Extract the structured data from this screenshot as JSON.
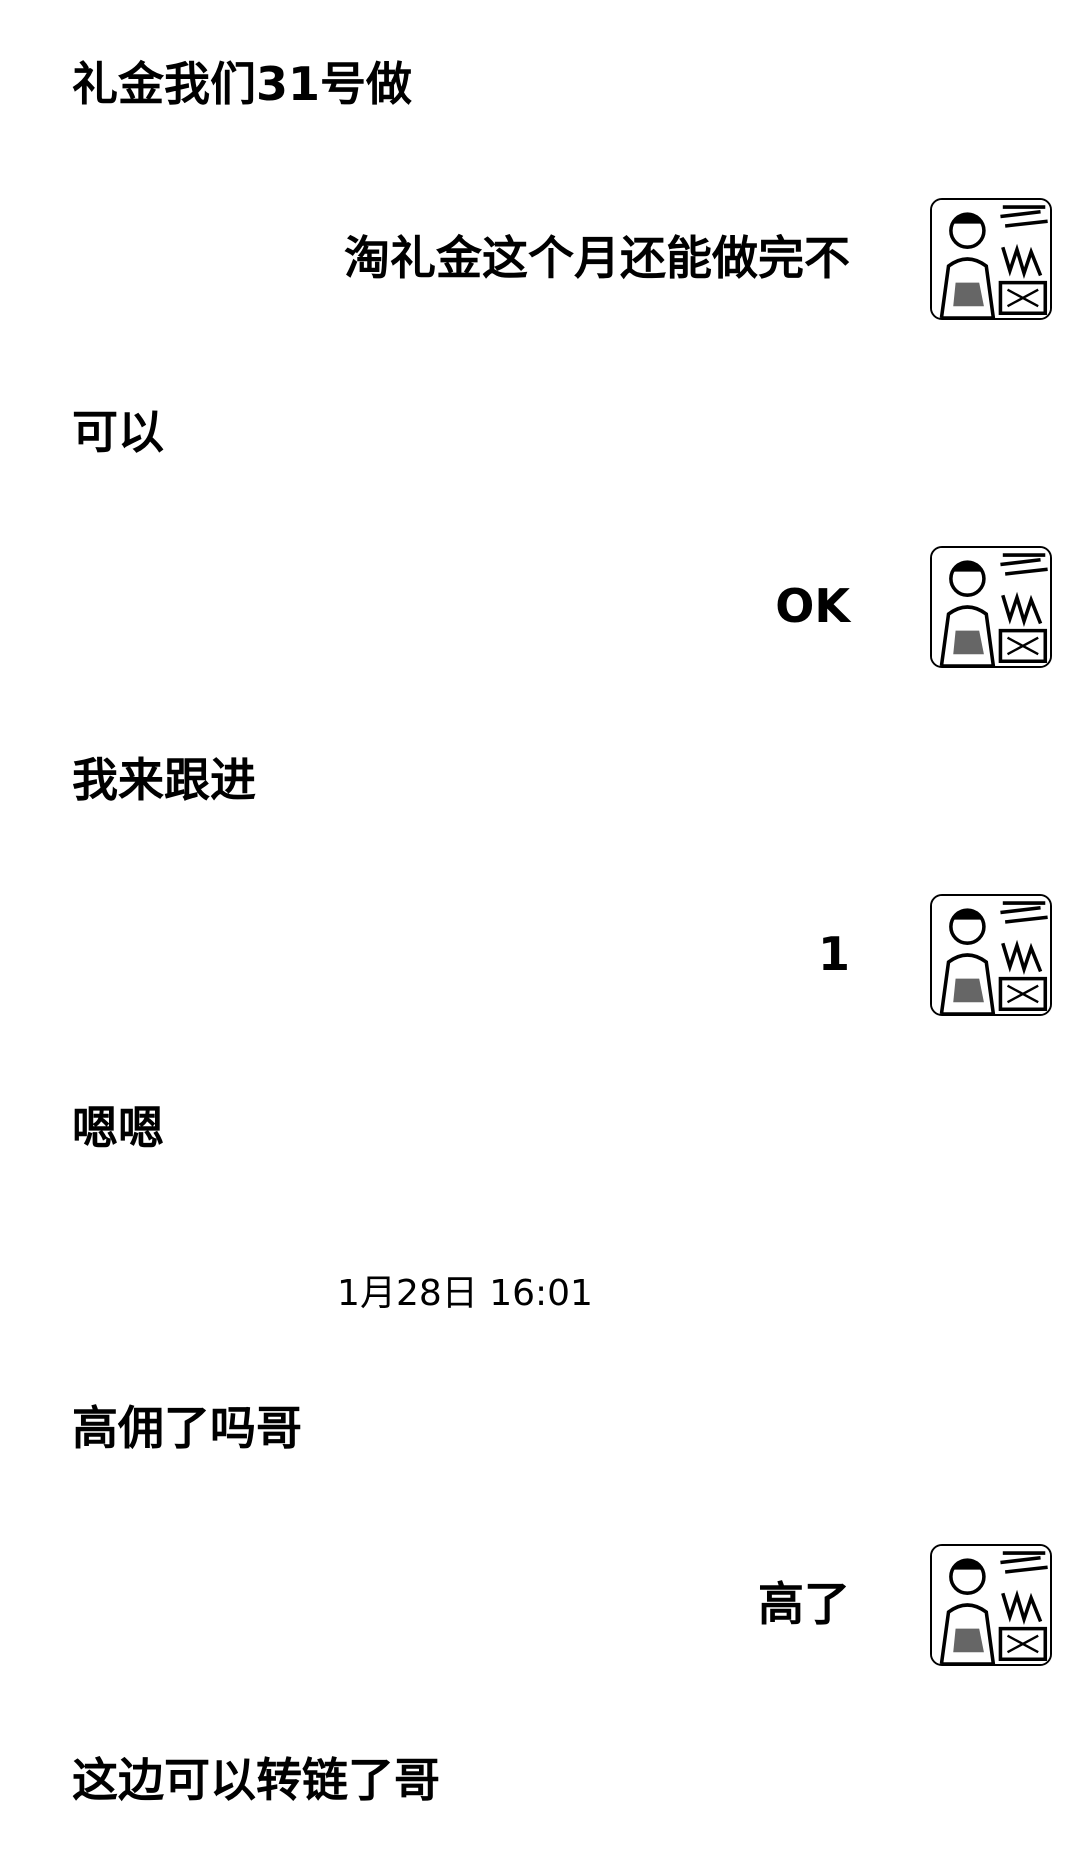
{
  "chat": {
    "messages": [
      {
        "side": "left",
        "text": "礼金我们31号做"
      },
      {
        "side": "right",
        "text": "淘礼金这个月还能做完不",
        "avatar": "user-avatar-icon"
      },
      {
        "side": "left",
        "text": "可以"
      },
      {
        "side": "right",
        "text": "OK",
        "avatar": "user-avatar-icon"
      },
      {
        "side": "left",
        "text": "我来跟进"
      },
      {
        "side": "right",
        "text": "1",
        "avatar": "user-avatar-icon"
      },
      {
        "side": "left",
        "text": "嗯嗯"
      },
      {
        "side": "timestamp",
        "text": "1月28日 16:01"
      },
      {
        "side": "left",
        "text": "高佣了吗哥"
      },
      {
        "side": "right",
        "text": "高了",
        "avatar": "user-avatar-icon"
      },
      {
        "side": "left",
        "text": "这边可以转链了哥"
      }
    ]
  }
}
